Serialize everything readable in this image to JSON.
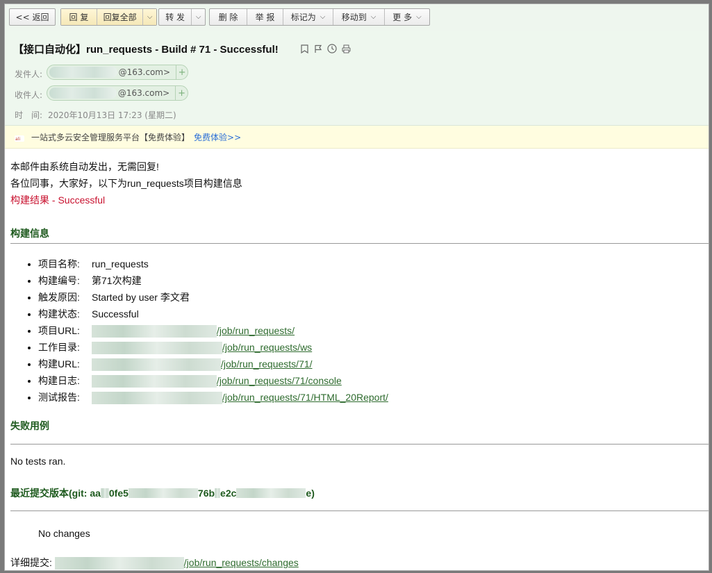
{
  "toolbar": {
    "back": "<< 返回",
    "reply": "回 复",
    "reply_all": "回复全部",
    "forward": "转 发",
    "delete": "删 除",
    "report": "举 报",
    "mark_as": "标记为",
    "move_to": "移动到",
    "more": "更 多"
  },
  "header": {
    "subject": "【接口自动化】run_requests - Build # 71 - Successful!",
    "from_label": "发件人:",
    "from_domain": "@163.com>",
    "to_label": "收件人:",
    "to_domain": "@163.com>",
    "time_label": "时　间:",
    "time_value": "2020年10月13日 17:23 (星期二)",
    "icons": [
      "bookmark-icon",
      "flag-icon",
      "clock-icon",
      "print-icon"
    ]
  },
  "banner": {
    "text": "一站式多云安全管理服务平台【免费体验】",
    "link": "免费体验>>"
  },
  "body": {
    "line1": "本邮件由系统自动发出，无需回复!",
    "line2": "各位同事，大家好，以下为run_requests项目构建信息",
    "result": "构建结果 - Successful",
    "build_info_title": "构建信息",
    "items": [
      {
        "key": "项目名称:",
        "value": "run_requests"
      },
      {
        "key": "构建编号:",
        "value": "第71次构建"
      },
      {
        "key": "触发原因:",
        "value": "Started by user 李文君"
      },
      {
        "key": "构建状态:",
        "value": "Successful"
      },
      {
        "key": "项目URL:",
        "value": "/job/run_requests/"
      },
      {
        "key": "工作目录:",
        "value": "/job/run_requests/ws"
      },
      {
        "key": "构建URL:",
        "value": "/job/run_requests/71/"
      },
      {
        "key": "构建日志:",
        "value": "/job/run_requests/71/console"
      },
      {
        "key": "测试报告:",
        "value": "/job/run_requests/71/HTML_20Report/"
      }
    ],
    "failed_title": "失败用例",
    "no_tests": "No tests ran.",
    "commit_title": "最近提交版本(git: aa",
    "commit_mid": "0fe5",
    "commit_mid2": "76b",
    "commit_mid3": "e2c",
    "commit_end": "e)",
    "no_changes": "No changes",
    "detail_label": "详细提交:",
    "detail_link": "/job/run_requests/changes"
  }
}
